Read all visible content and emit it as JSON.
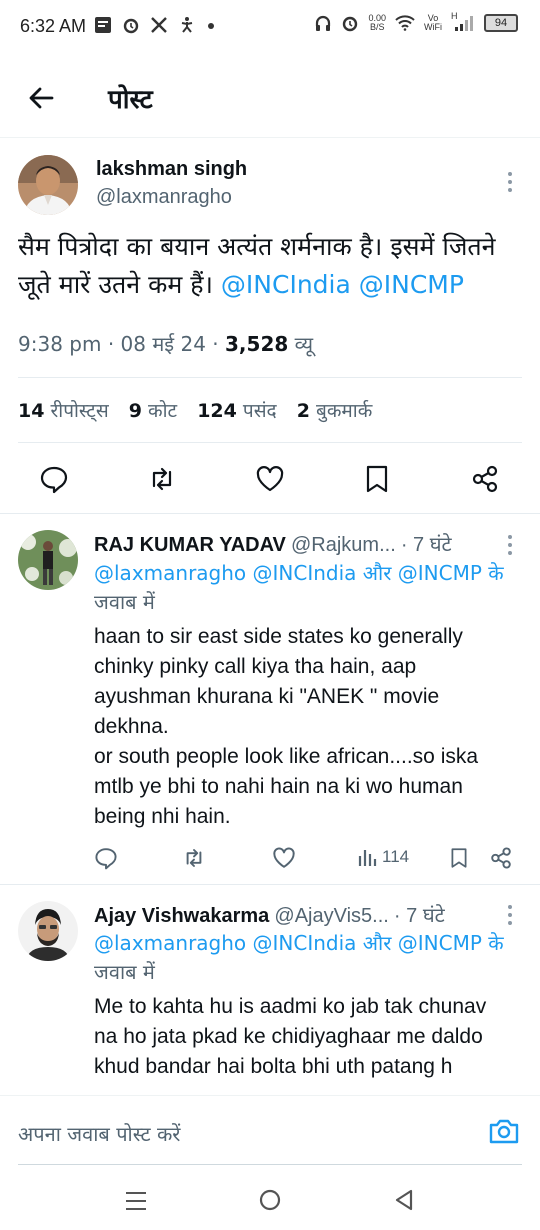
{
  "status_bar": {
    "time": "6:32 AM",
    "net_speed_value": "0.00",
    "net_speed_unit": "B/S",
    "volte_top": "Vo",
    "volte_bottom": "WiFi",
    "signal_label": "H",
    "battery": "94",
    "icons": [
      "notes-icon",
      "alarm-icon",
      "x-logo-icon",
      "accessibility-icon",
      "dot-icon",
      "headphones-icon",
      "alarm-icon",
      "wifi-icon",
      "signal-icon",
      "battery-icon"
    ]
  },
  "header": {
    "title": "पोस्ट"
  },
  "post": {
    "author_name": "lakshman singh",
    "author_handle": "@laxmanragho",
    "text_line1": "सैम पित्रोदा का बयान अत्यंत शर्मनाक है। इसमें जितने",
    "text_line2_prefix": "जूते मारें उतने कम हैं।",
    "mention1": "@INCIndia",
    "mention2": "@INCMP",
    "time": "9:38 pm",
    "date": "08 मई 24",
    "views_count": "3,528",
    "views_label": "व्यू",
    "sep": "·",
    "stats": {
      "reposts_count": "14",
      "reposts_label": "रीपोस्ट्स",
      "quotes_count": "9",
      "quotes_label": "कोट",
      "likes_count": "124",
      "likes_label": "पसंद",
      "bookmarks_count": "2",
      "bookmarks_label": "बुकमार्क"
    }
  },
  "replies": [
    {
      "name": "RAJ KUMAR YADAV",
      "handle": "@Rajkum...",
      "time": "· 7 घंटे",
      "reply_to_1": "@laxmanragho",
      "reply_to_2": "@INCIndia",
      "reply_and": "और",
      "reply_to_3": "@INCMP",
      "reply_suffix_1": "के",
      "reply_suffix_2": "जवाब में",
      "text": "haan to sir east side states ko generally\nchinky pinky call kiya tha hain, aap\nayushman khurana ki \"ANEK \" movie\ndekhna.\nor south people look like african....so iska\nmtlb ye bhi to nahi hain na ki wo human\nbeing nhi hain.",
      "views": "114"
    },
    {
      "name": "Ajay Vishwakarma",
      "handle": "@AjayVis5...",
      "time": "· 7 घंटे",
      "reply_to_1": "@laxmanragho",
      "reply_to_2": "@INCIndia",
      "reply_and": "और",
      "reply_to_3": "@INCMP",
      "reply_suffix_1": "के",
      "reply_suffix_2": "जवाब में",
      "text": "Me to kahta hu is aadmi ko jab tak chunav\nna ho jata pkad ke chidiyaghaar me daldo\nkhud bandar hai bolta bhi uth patang h"
    }
  ],
  "composer": {
    "placeholder": "अपना जवाब पोस्ट करें"
  },
  "colors": {
    "accent": "#1d9bf0",
    "text": "#0f1419",
    "muted": "#536471",
    "divider": "#eff3f4"
  }
}
